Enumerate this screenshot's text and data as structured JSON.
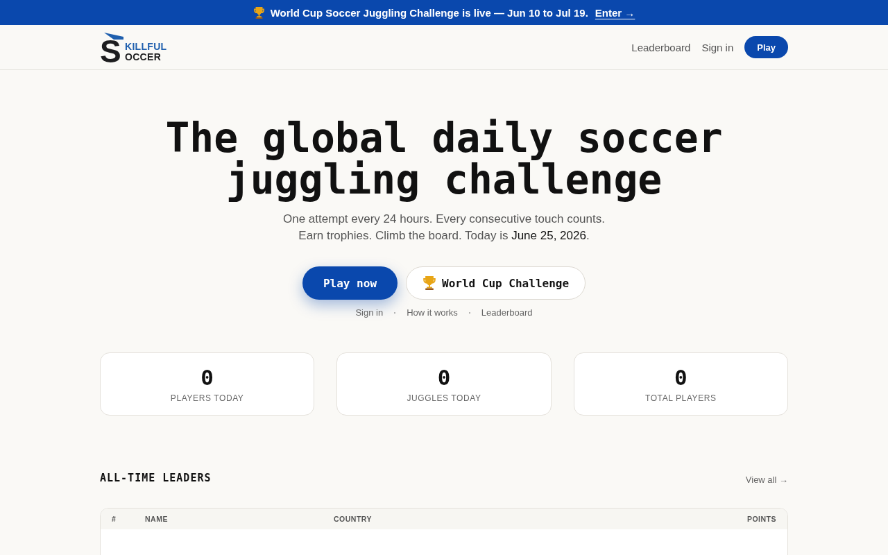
{
  "announcement": {
    "message": "World Cup Soccer Juggling Challenge is live — Jun 10 to Jul 19.",
    "link": "Enter →"
  },
  "header": {
    "logo": {
      "initial": "S",
      "line_1": "KILLFUL",
      "line_2": "OCCER"
    },
    "nav": [
      "Leaderboard",
      "Sign in"
    ],
    "cta": "Play"
  },
  "hero": {
    "title": "The global daily soccer juggling challenge",
    "subtitle": "One attempt every 24 hours. Every consecutive touch counts. Earn trophies. Climb the board. Today is **June 25, 2026**.",
    "primary_button": "Play now",
    "secondary_button": "World Cup Challenge",
    "links": [
      "Sign in",
      "How it works",
      "Leaderboard"
    ]
  },
  "stats": [
    {
      "value": "0",
      "label": "PLAYERS TODAY"
    },
    {
      "value": "0",
      "label": "JUGGLES TODAY"
    },
    {
      "value": "0",
      "label": "TOTAL PLAYERS"
    }
  ],
  "leaders": {
    "title": "ALL-TIME LEADERS",
    "view_all": "View all →",
    "table": {
      "columns": [
        "#",
        "NAME",
        "COUNTRY",
        "POINTS"
      ]
    }
  }
}
